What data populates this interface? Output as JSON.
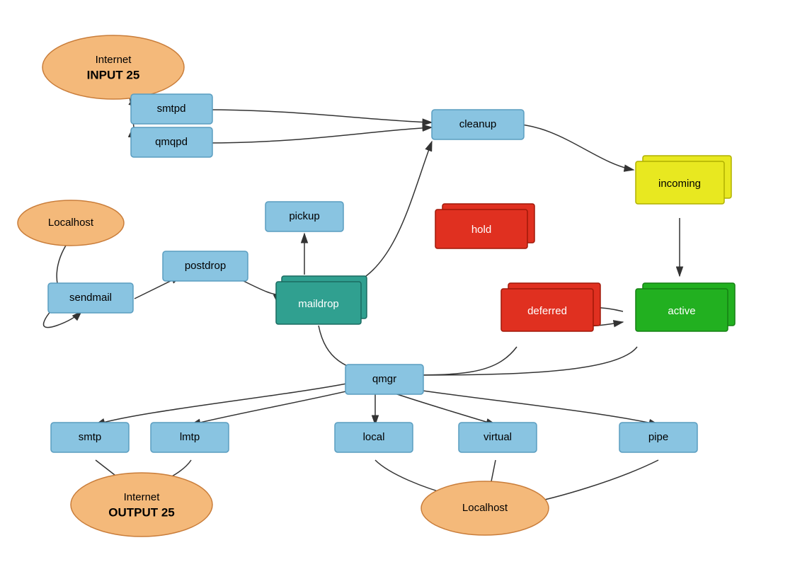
{
  "nodes": {
    "internet_input": {
      "label_line1": "Internet",
      "label_line2": "INPUT 25"
    },
    "smtpd": {
      "label": "smtpd"
    },
    "qmqpd": {
      "label": "qmqpd"
    },
    "localhost_top": {
      "label": "Localhost"
    },
    "postdrop": {
      "label": "postdrop"
    },
    "sendmail": {
      "label": "sendmail"
    },
    "pickup": {
      "label": "pickup"
    },
    "maildrop": {
      "label": "maildrop"
    },
    "cleanup": {
      "label": "cleanup"
    },
    "hold": {
      "label": "hold"
    },
    "incoming": {
      "label": "incoming"
    },
    "deferred": {
      "label": "deferred"
    },
    "active": {
      "label": "active"
    },
    "qmgr": {
      "label": "qmgr"
    },
    "smtp": {
      "label": "smtp"
    },
    "lmtp": {
      "label": "lmtp"
    },
    "local": {
      "label": "local"
    },
    "virtual": {
      "label": "virtual"
    },
    "pipe": {
      "label": "pipe"
    },
    "internet_output": {
      "label_line1": "Internet",
      "label_line2": "OUTPUT 25"
    },
    "localhost_bottom": {
      "label": "Localhost"
    }
  }
}
